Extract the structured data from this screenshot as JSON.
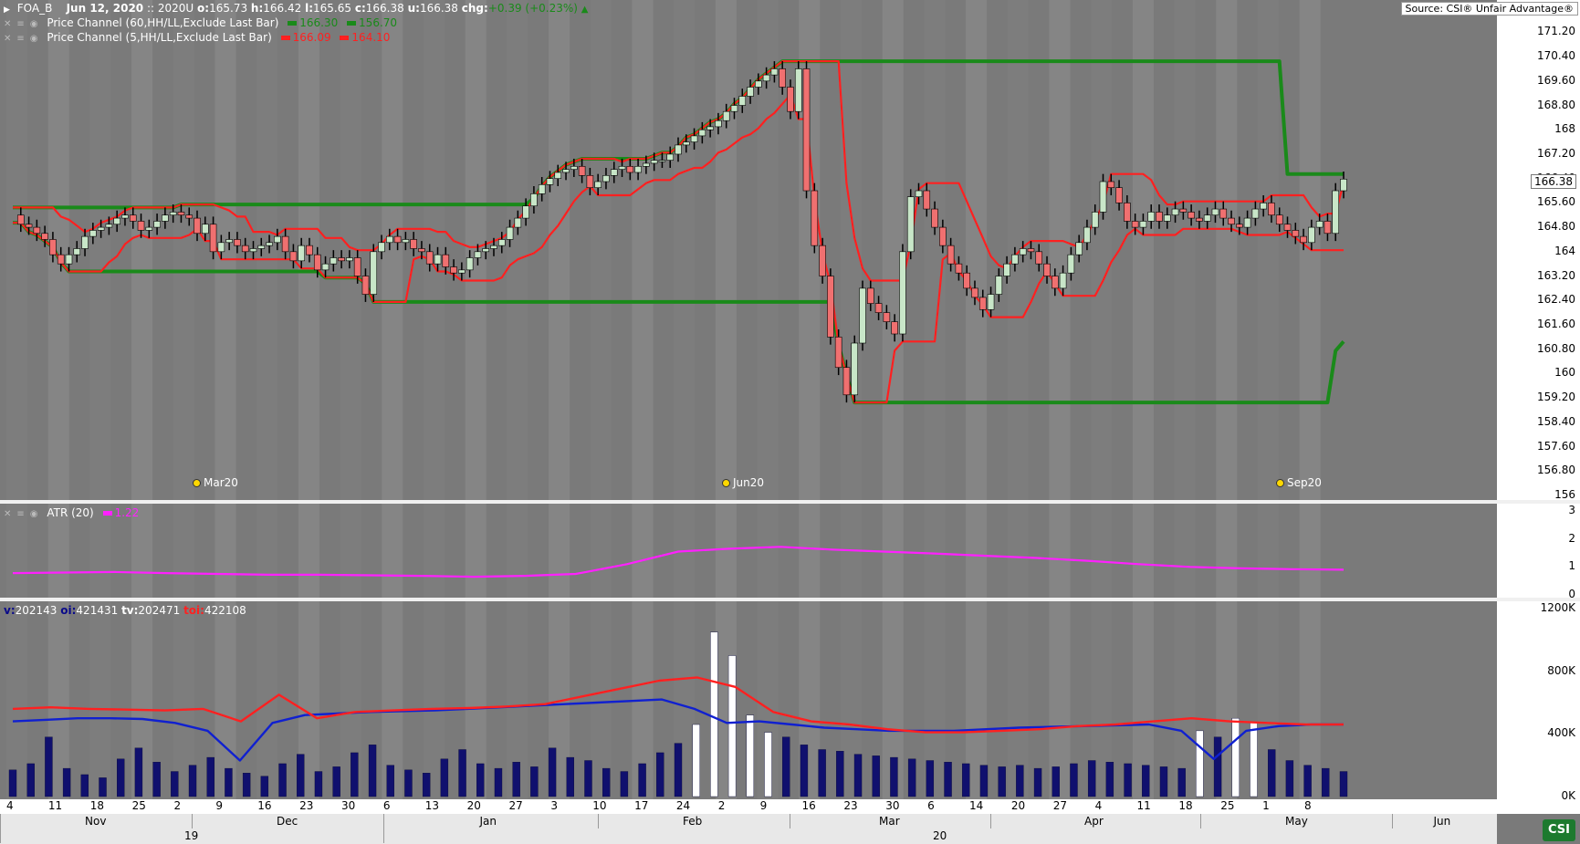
{
  "header": {
    "symbol": "FOA_B",
    "date": "Jun 12, 2020",
    "contract": ":: 2020U",
    "o_label": "o:",
    "o": "165.73",
    "h_label": "h:",
    "h": "166.42",
    "l_label": "l:",
    "l": "165.65",
    "c_label": "c:",
    "c": "166.38",
    "u_label": "u:",
    "u": "166.38",
    "chg_label": "chg:",
    "chg": "+0.39 (+0.23%)",
    "chg_icon": "triangle-up-icon",
    "source": "Source: CSI® Unfair Advantage®"
  },
  "legends": {
    "price_channel_60": {
      "label": "Price Channel (60,HH/LL,Exclude Last Bar)",
      "upper": "166.30",
      "lower": "156.70",
      "color": "#1a8a1a"
    },
    "price_channel_5": {
      "label": "Price Channel (5,HH/LL,Exclude Last Bar)",
      "upper": "166.09",
      "lower": "164.10",
      "color": "#ff2020"
    },
    "atr": {
      "label": "ATR (20)",
      "value": "1.22",
      "color": "#ff20ff"
    },
    "volume": {
      "v_label": "v:",
      "v": "202143",
      "oi_label": "oi:",
      "oi": "421431",
      "tv_label": "tv:",
      "tv": "202471",
      "toi_label": "toi:",
      "toi": "422108"
    }
  },
  "price_axis": [
    "171.20",
    "170.40",
    "169.60",
    "168.80",
    "168",
    "167.20",
    "166.40",
    "165.60",
    "164.80",
    "164",
    "163.20",
    "162.40",
    "161.60",
    "160.80",
    "160",
    "159.20",
    "158.40",
    "157.60",
    "156.80",
    "156"
  ],
  "current_price": "166.38",
  "atr_axis": [
    "3",
    "2",
    "1",
    "0"
  ],
  "volume_axis": [
    "1200K",
    "800K",
    "400K",
    "0K"
  ],
  "contract_markers": [
    {
      "label": "Mar20",
      "x": 215
    },
    {
      "label": "Jun20",
      "x": 795
    },
    {
      "label": "Sep20",
      "x": 1402
    }
  ],
  "date_labels": [
    "4",
    "11",
    "18",
    "25",
    "2",
    "9",
    "16",
    "23",
    "30",
    "6",
    "13",
    "20",
    "27",
    "3",
    "10",
    "17",
    "24",
    "2",
    "9",
    "16",
    "23",
    "30",
    "6",
    "14",
    "20",
    "27",
    "4",
    "11",
    "18",
    "25",
    "1",
    "8"
  ],
  "months": [
    "Nov",
    "Dec",
    "Jan",
    "Feb",
    "Mar",
    "Apr",
    "May",
    "Jun"
  ],
  "years": [
    "19",
    "20"
  ],
  "logo_text": "CSI",
  "chart_data": [
    {
      "type": "candlestick",
      "title": "",
      "ylim": [
        156,
        171.6
      ],
      "series": [
        {
          "name": "Price Channel (60,HH/LL,Exclude Last Bar)"
        },
        {
          "name": "Price Channel (5,HH/LL,Exclude Last Bar)"
        }
      ],
      "close": [
        165.2,
        164.9,
        164.8,
        164.6,
        164.4,
        163.9,
        163.6,
        163.9,
        164.1,
        164.5,
        164.7,
        164.8,
        164.9,
        165.1,
        165.2,
        165.0,
        164.7,
        164.8,
        165.0,
        165.2,
        165.3,
        165.2,
        165.1,
        164.6,
        164.9,
        164.0,
        164.3,
        164.4,
        164.2,
        164.0,
        164.1,
        164.2,
        164.3,
        164.5,
        164.0,
        163.7,
        164.2,
        163.9,
        163.4,
        163.6,
        163.8,
        163.7,
        163.8,
        163.2,
        162.6,
        164.0,
        164.3,
        164.5,
        164.3,
        164.4,
        164.1,
        164.0,
        163.6,
        163.9,
        163.5,
        163.3,
        163.4,
        163.8,
        164.0,
        164.1,
        164.2,
        164.4,
        164.8,
        165.1,
        165.5,
        165.9,
        166.2,
        166.4,
        166.6,
        166.7,
        166.8,
        166.5,
        166.1,
        166.3,
        166.5,
        166.7,
        166.8,
        166.6,
        166.8,
        166.9,
        167.0,
        167.0,
        167.2,
        167.5,
        167.6,
        167.8,
        168.0,
        168.1,
        168.3,
        168.6,
        168.8,
        169.1,
        169.4,
        169.6,
        169.8,
        170.0,
        169.4,
        168.6,
        170.0,
        166.0,
        164.2,
        163.2,
        161.2,
        160.2,
        159.3,
        161.0,
        162.8,
        162.3,
        162.0,
        161.7,
        161.3,
        164.0,
        165.8,
        166.0,
        165.4,
        164.8,
        164.2,
        163.6,
        163.3,
        162.8,
        162.5,
        162.1,
        162.6,
        163.2,
        163.6,
        163.9,
        164.1,
        164.0,
        163.6,
        163.2,
        162.8,
        163.3,
        163.9,
        164.3,
        164.8,
        165.3,
        166.3,
        166.1,
        165.6,
        165.0,
        164.8,
        165.0,
        165.3,
        165.0,
        165.2,
        165.4,
        165.3,
        165.1,
        165.0,
        165.2,
        165.4,
        165.1,
        164.9,
        164.8,
        165.1,
        165.4,
        165.6,
        165.2,
        164.9,
        164.7,
        164.5,
        164.3,
        164.8,
        165.0,
        164.6,
        166.0,
        166.38
      ]
    },
    {
      "type": "line",
      "title": "",
      "ylim": [
        0,
        3
      ],
      "series": [
        {
          "name": "ATR (20)",
          "values": [
            0.78,
            0.8,
            0.82,
            0.78,
            0.75,
            0.72,
            0.72,
            0.7,
            0.68,
            0.65,
            0.68,
            0.75,
            1.1,
            1.55,
            1.65,
            1.72,
            1.62,
            1.55,
            1.48,
            1.4,
            1.32,
            1.22,
            1.1,
            1.0,
            0.95,
            0.92,
            0.9
          ]
        }
      ]
    },
    {
      "type": "bar",
      "title": "",
      "ylim": [
        0,
        1200
      ],
      "series": [
        {
          "name": "v",
          "values": [
            170,
            210,
            380,
            180,
            140,
            120,
            240,
            310,
            220,
            160,
            200,
            250,
            180,
            150,
            130,
            210,
            270,
            160,
            190,
            280,
            330,
            200,
            170,
            150,
            240,
            300,
            210,
            180,
            220,
            190,
            310,
            250,
            230,
            180,
            160,
            210,
            280,
            340,
            460,
            1050,
            900,
            520,
            410,
            380,
            330,
            300,
            290,
            270,
            260,
            250,
            240,
            230,
            220,
            210,
            200,
            190,
            200,
            180,
            190,
            210,
            230,
            220,
            210,
            200,
            190,
            180,
            420,
            380,
            500,
            470,
            300,
            230,
            200,
            180,
            160
          ]
        },
        {
          "name": "oi",
          "values": [
            480,
            490,
            500,
            500,
            495,
            470,
            420,
            230,
            470,
            520,
            530,
            540,
            545,
            550,
            560,
            570,
            580,
            590,
            600,
            610,
            620,
            560,
            470,
            480,
            460,
            440,
            430,
            420,
            420,
            420,
            430,
            440,
            445,
            450,
            455,
            460,
            420,
            240,
            420,
            450,
            460,
            460
          ]
        },
        {
          "name": "toi",
          "values": [
            560,
            570,
            560,
            555,
            550,
            560,
            480,
            650,
            500,
            540,
            550,
            560,
            565,
            575,
            590,
            640,
            690,
            740,
            760,
            700,
            540,
            480,
            460,
            430,
            410,
            410,
            420,
            430,
            450,
            460,
            480,
            500,
            480,
            470,
            460,
            460
          ]
        }
      ]
    }
  ]
}
